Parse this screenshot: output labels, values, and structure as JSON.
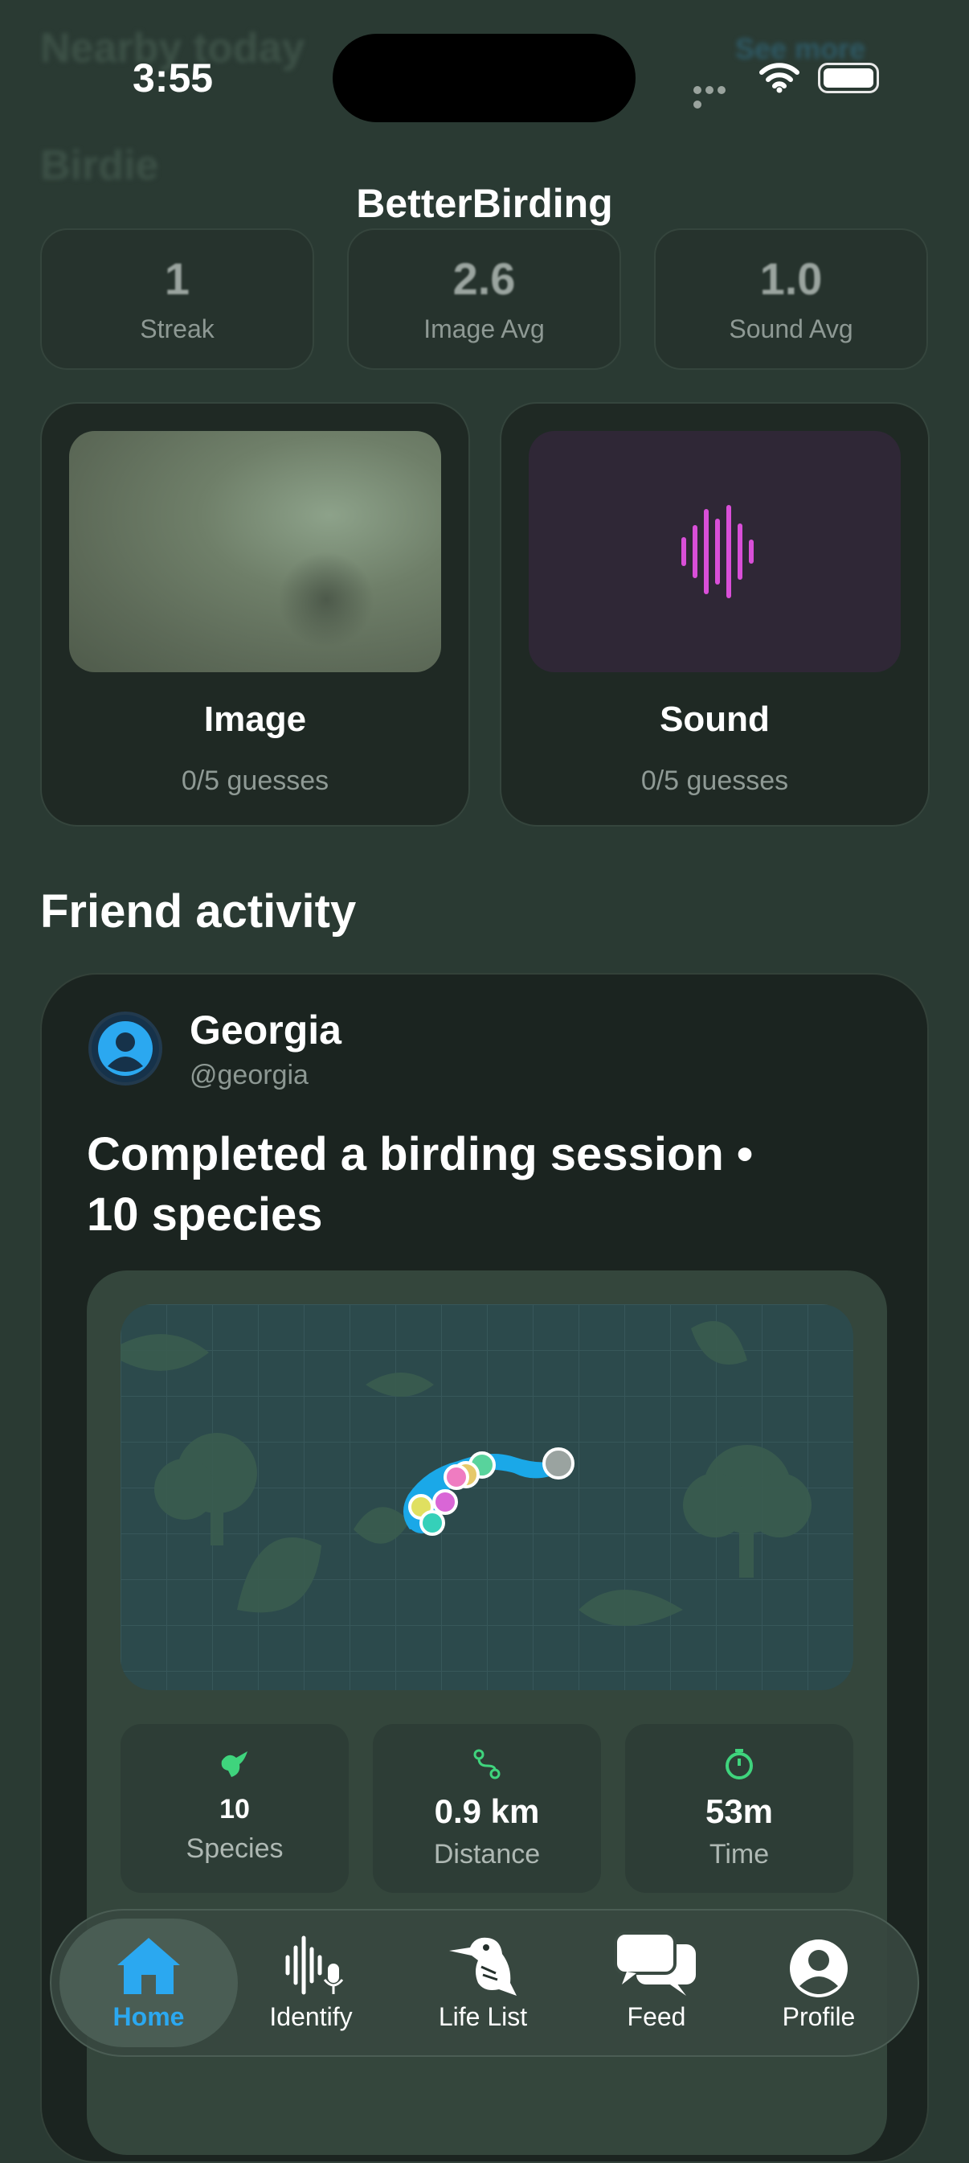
{
  "background_header": {
    "title": "Nearby today",
    "subtitle": "Birdie",
    "link": "See more"
  },
  "status_bar": {
    "time": "3:55"
  },
  "app": {
    "title": "BetterBirding"
  },
  "stats": [
    {
      "value": "1",
      "label": "Streak"
    },
    {
      "value": "2.6",
      "label": "Image Avg"
    },
    {
      "value": "1.0",
      "label": "Sound Avg"
    }
  ],
  "games": [
    {
      "title": "Image",
      "progress": "0/5 guesses",
      "icon": "photo-thumbnail"
    },
    {
      "title": "Sound",
      "progress": "0/5 guesses",
      "icon": "waveform-icon"
    }
  ],
  "friend_activity": {
    "heading": "Friend activity",
    "post": {
      "name": "Georgia",
      "handle": "@georgia",
      "headline": "Completed a birding session • 10 species",
      "metrics": [
        {
          "value": "10",
          "label": "Species",
          "icon": "bird-icon"
        },
        {
          "value": "0.9 km",
          "label": "Distance",
          "icon": "route-icon"
        },
        {
          "value": "53m",
          "label": "Time",
          "icon": "timer-icon"
        }
      ]
    }
  },
  "tabbar": {
    "tabs": [
      {
        "label": "Home",
        "icon": "house-icon",
        "active": true
      },
      {
        "label": "Identify",
        "icon": "waveform-mic-icon"
      },
      {
        "label": "Life List",
        "icon": "kookaburra-icon"
      },
      {
        "label": "Feed",
        "icon": "chat-bubbles-icon"
      },
      {
        "label": "Profile",
        "icon": "person-circle-icon"
      }
    ]
  },
  "colors": {
    "accent": "#2ba8f0",
    "sound_accent": "#d94fd8",
    "metric_icon": "#3fd47d"
  }
}
